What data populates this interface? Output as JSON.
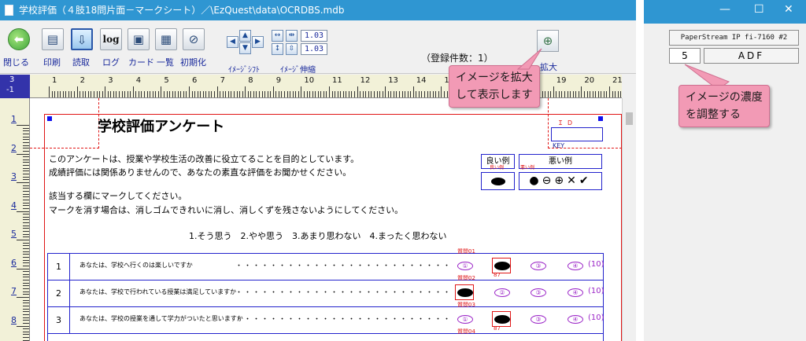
{
  "window": {
    "title": "学校評価（４肢18問片面－マークシート）／\\EzQuest\\data\\OCRDBS.mdb"
  },
  "toolbar": {
    "buttons": [
      {
        "label": "閉じる",
        "icon": "back-arrow-icon"
      },
      {
        "label": "印刷",
        "icon": "printer-icon"
      },
      {
        "label": "読取",
        "icon": "scanner-icon"
      },
      {
        "label": "ログ",
        "icon": "log-icon",
        "glyph": "log"
      },
      {
        "label": "カード",
        "icon": "card-icon"
      },
      {
        "label": "一覧",
        "icon": "list-icon"
      },
      {
        "label": "初期化",
        "icon": "reset-icon"
      }
    ],
    "shift_label": "ｲﾒｰｼﾞｼﾌﾄ",
    "stretch_label": "ｲﾒｰｼﾞ伸縮",
    "stretch_x": "1.03",
    "stretch_y": "1.03",
    "record_count": "（登録件数：1）",
    "zoom_label": "拡大"
  },
  "ruler": {
    "corner_top": "3",
    "corner_bottom": "-1",
    "h_numbers": [
      "1",
      "2",
      "3",
      "4",
      "5",
      "6",
      "7",
      "8",
      "9",
      "10",
      "11",
      "12",
      "13",
      "14",
      "15",
      "16",
      "17",
      "18",
      "19",
      "20",
      "21"
    ],
    "v_numbers": [
      "1",
      "2",
      "3",
      "4",
      "5",
      "6",
      "7",
      "8"
    ]
  },
  "form": {
    "title": "学校評価アンケート",
    "id_label": "ＩＤ",
    "key_label": "KEY",
    "intro_1": "このアンケートは、授業や学校生活の改善に役立てることを目的としています。",
    "intro_2": "成績評価には関係ありませんので、あなたの素直な評価をお聞かせください。",
    "instr_1": "該当する欄にマークしてください。",
    "instr_2": "マークを消す場合は、消しゴムできれいに消し、消しくずを残さないようにしてください。",
    "scale": "1.そう思う　2.やや思う　3.あまり思わない　4.まったく思わない",
    "good_example": "良い例",
    "bad_example": "悪い例",
    "good_sub": "良い例",
    "bad_sub": "悪い例",
    "bad_marks": "●⊖⊕✕✔",
    "questions": [
      {
        "no": "1",
        "text": "あなたは、学校へ行くのは楽しいですか",
        "qid": "質問01",
        "options": [
          "①",
          "②",
          "③",
          "④"
        ],
        "filled": 1,
        "weight": "(10)",
        "ocr": "87"
      },
      {
        "no": "2",
        "text": "あなたは、学校で行われている授業は満足していますか",
        "qid": "質問02",
        "options": [
          "①",
          "②",
          "③",
          "④"
        ],
        "filled": 0,
        "weight": "(10)",
        "ocr": ""
      },
      {
        "no": "3",
        "text": "あなたは、学校の授業を通して学力がついたと思いますか",
        "qid": "質問03",
        "options": [
          "①",
          "②",
          "③",
          "④"
        ],
        "filled": 1,
        "weight": "(10)",
        "ocr": "87"
      }
    ],
    "next_qid": "質問04"
  },
  "callouts": {
    "zoom_line1": "イメージを拡大",
    "zoom_line2": "して表示します",
    "density_line1": "イメージの濃度",
    "density_line2": "を調整する"
  },
  "scanner": {
    "name": "PaperStream IP fi-7160 #2",
    "density": "5",
    "source": "ADF",
    "minimize": "—",
    "maximize": "☐",
    "close": "✕"
  },
  "colors": {
    "titlebar": "#2f96d2",
    "callout": "#f29ab5",
    "form_red": "#e01515",
    "form_blue": "#2222cc"
  }
}
